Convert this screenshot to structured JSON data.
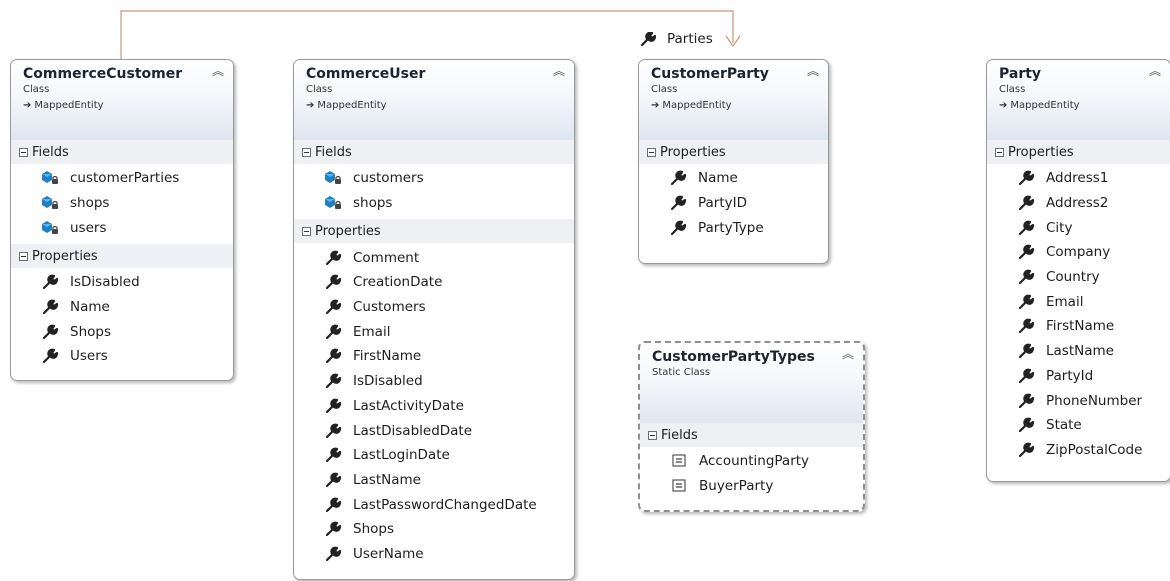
{
  "relationship": {
    "label": "Parties",
    "icon": "wrench-icon"
  },
  "classes": [
    {
      "id": "commerce-customer",
      "title": "CommerceCustomer",
      "kind": "Class",
      "base": "MappedEntity",
      "sections": [
        {
          "title": "Fields",
          "items": [
            {
              "name": "customerParties",
              "icon": "field-icon"
            },
            {
              "name": "shops",
              "icon": "field-icon"
            },
            {
              "name": "users",
              "icon": "field-icon"
            }
          ]
        },
        {
          "title": "Properties",
          "items": [
            {
              "name": "IsDisabled",
              "icon": "wrench-icon"
            },
            {
              "name": "Name",
              "icon": "wrench-icon"
            },
            {
              "name": "Shops",
              "icon": "wrench-icon"
            },
            {
              "name": "Users",
              "icon": "wrench-icon"
            }
          ]
        }
      ]
    },
    {
      "id": "commerce-user",
      "title": "CommerceUser",
      "kind": "Class",
      "base": "MappedEntity",
      "sections": [
        {
          "title": "Fields",
          "items": [
            {
              "name": "customers",
              "icon": "field-icon"
            },
            {
              "name": "shops",
              "icon": "field-icon"
            }
          ]
        },
        {
          "title": "Properties",
          "items": [
            {
              "name": "Comment",
              "icon": "wrench-icon"
            },
            {
              "name": "CreationDate",
              "icon": "wrench-icon"
            },
            {
              "name": "Customers",
              "icon": "wrench-icon"
            },
            {
              "name": "Email",
              "icon": "wrench-icon"
            },
            {
              "name": "FirstName",
              "icon": "wrench-icon"
            },
            {
              "name": "IsDisabled",
              "icon": "wrench-icon"
            },
            {
              "name": "LastActivityDate",
              "icon": "wrench-icon"
            },
            {
              "name": "LastDisabledDate",
              "icon": "wrench-icon"
            },
            {
              "name": "LastLoginDate",
              "icon": "wrench-icon"
            },
            {
              "name": "LastName",
              "icon": "wrench-icon"
            },
            {
              "name": "LastPasswordChangedDate",
              "icon": "wrench-icon"
            },
            {
              "name": "Shops",
              "icon": "wrench-icon"
            },
            {
              "name": "UserName",
              "icon": "wrench-icon"
            }
          ]
        }
      ]
    },
    {
      "id": "customer-party",
      "title": "CustomerParty",
      "kind": "Class",
      "base": "MappedEntity",
      "sections": [
        {
          "title": "Properties",
          "items": [
            {
              "name": "Name",
              "icon": "wrench-icon"
            },
            {
              "name": "PartyID",
              "icon": "wrench-icon"
            },
            {
              "name": "PartyType",
              "icon": "wrench-icon"
            }
          ]
        }
      ]
    },
    {
      "id": "customer-party-types",
      "title": "CustomerPartyTypes",
      "kind": "Static Class",
      "base": "",
      "sections": [
        {
          "title": "Fields",
          "items": [
            {
              "name": "AccountingParty",
              "icon": "constant-icon"
            },
            {
              "name": "BuyerParty",
              "icon": "constant-icon"
            }
          ]
        }
      ]
    },
    {
      "id": "party",
      "title": "Party",
      "kind": "Class",
      "base": "MappedEntity",
      "sections": [
        {
          "title": "Properties",
          "items": [
            {
              "name": "Address1",
              "icon": "wrench-icon"
            },
            {
              "name": "Address2",
              "icon": "wrench-icon"
            },
            {
              "name": "City",
              "icon": "wrench-icon"
            },
            {
              "name": "Company",
              "icon": "wrench-icon"
            },
            {
              "name": "Country",
              "icon": "wrench-icon"
            },
            {
              "name": "Email",
              "icon": "wrench-icon"
            },
            {
              "name": "FirstName",
              "icon": "wrench-icon"
            },
            {
              "name": "LastName",
              "icon": "wrench-icon"
            },
            {
              "name": "PartyId",
              "icon": "wrench-icon"
            },
            {
              "name": "PhoneNumber",
              "icon": "wrench-icon"
            },
            {
              "name": "State",
              "icon": "wrench-icon"
            },
            {
              "name": "ZipPostalCode",
              "icon": "wrench-icon"
            }
          ]
        }
      ]
    }
  ],
  "colors": {
    "connector": "#c8957a",
    "header_gradient_end": "#dfe5f0",
    "field_icon": "#1f7fc4"
  }
}
